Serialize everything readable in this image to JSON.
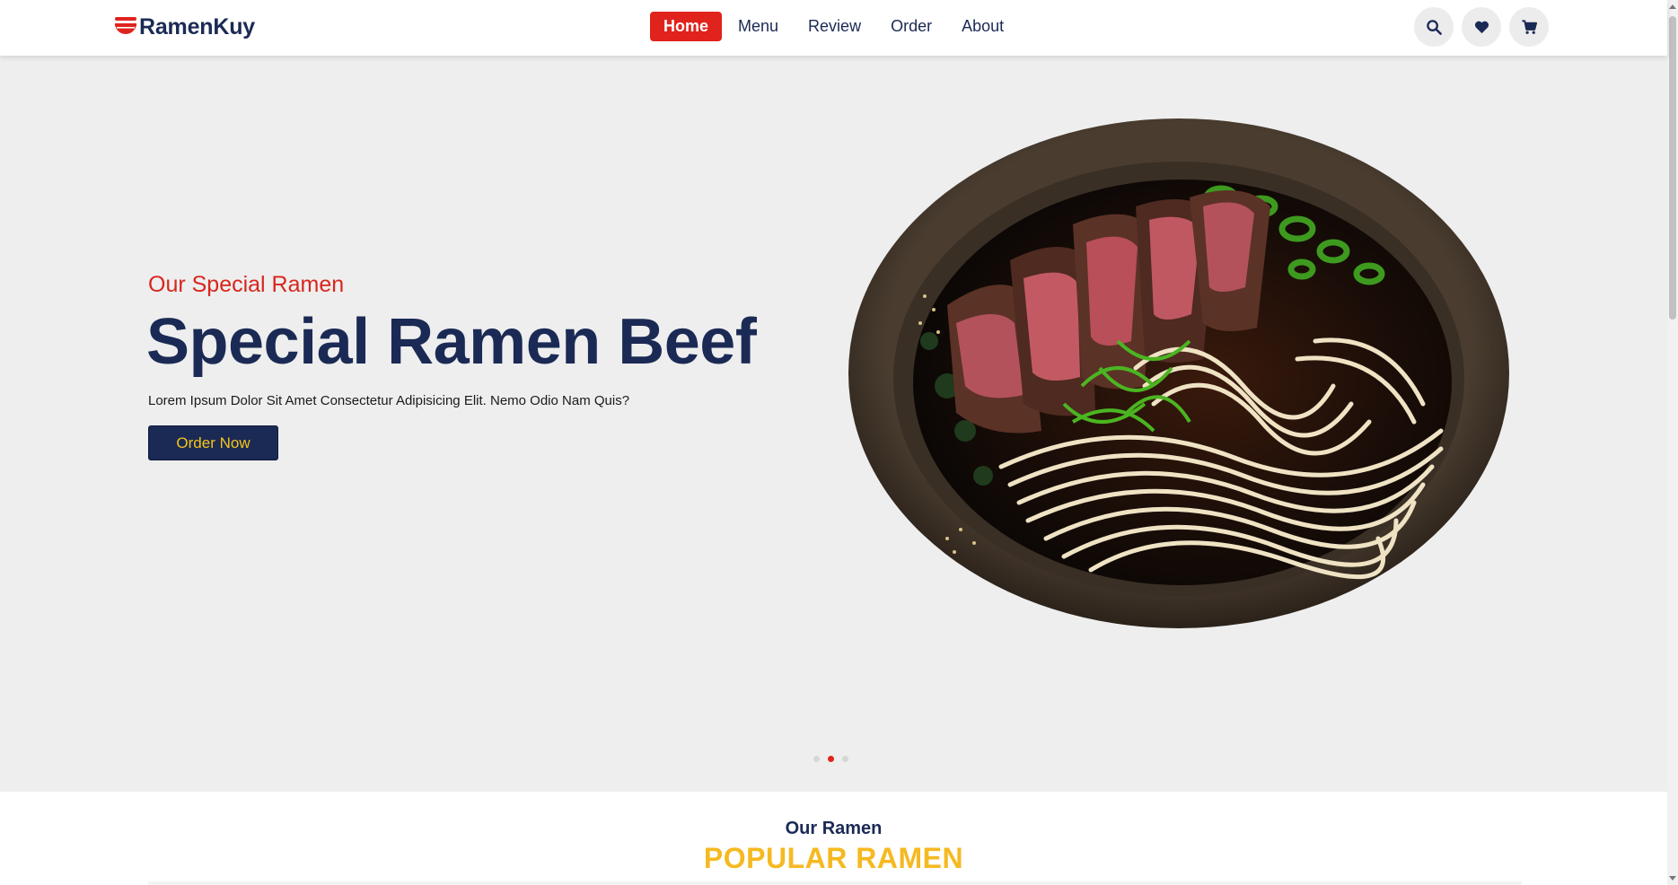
{
  "brand": {
    "name": "RamenKuy",
    "icon": "ramen-bowl-icon",
    "color": "#e0231d"
  },
  "nav": {
    "items": [
      {
        "label": "Home",
        "active": true
      },
      {
        "label": "Menu",
        "active": false
      },
      {
        "label": "Review",
        "active": false
      },
      {
        "label": "Order",
        "active": false
      },
      {
        "label": "About",
        "active": false
      }
    ]
  },
  "header_icons": [
    "search-icon",
    "heart-icon",
    "cart-icon"
  ],
  "hero": {
    "subtitle": "Our Special Ramen",
    "title": "Special Ramen Beef",
    "description": "Lorem Ipsum Dolor Sit Amet Consectetur Adipisicing Elit. Nemo Odio Nam Quis?",
    "button_label": "Order Now",
    "image": "ramen-bowl-image",
    "slides": {
      "count": 3,
      "active": 2
    }
  },
  "section": {
    "subtitle": "Our Ramen",
    "title": "POPULAR RAMEN"
  },
  "colors": {
    "primary": "#1b2a55",
    "accent_red": "#e0231d",
    "accent_yellow": "#f5b921",
    "hero_bg": "#eeeeee"
  }
}
